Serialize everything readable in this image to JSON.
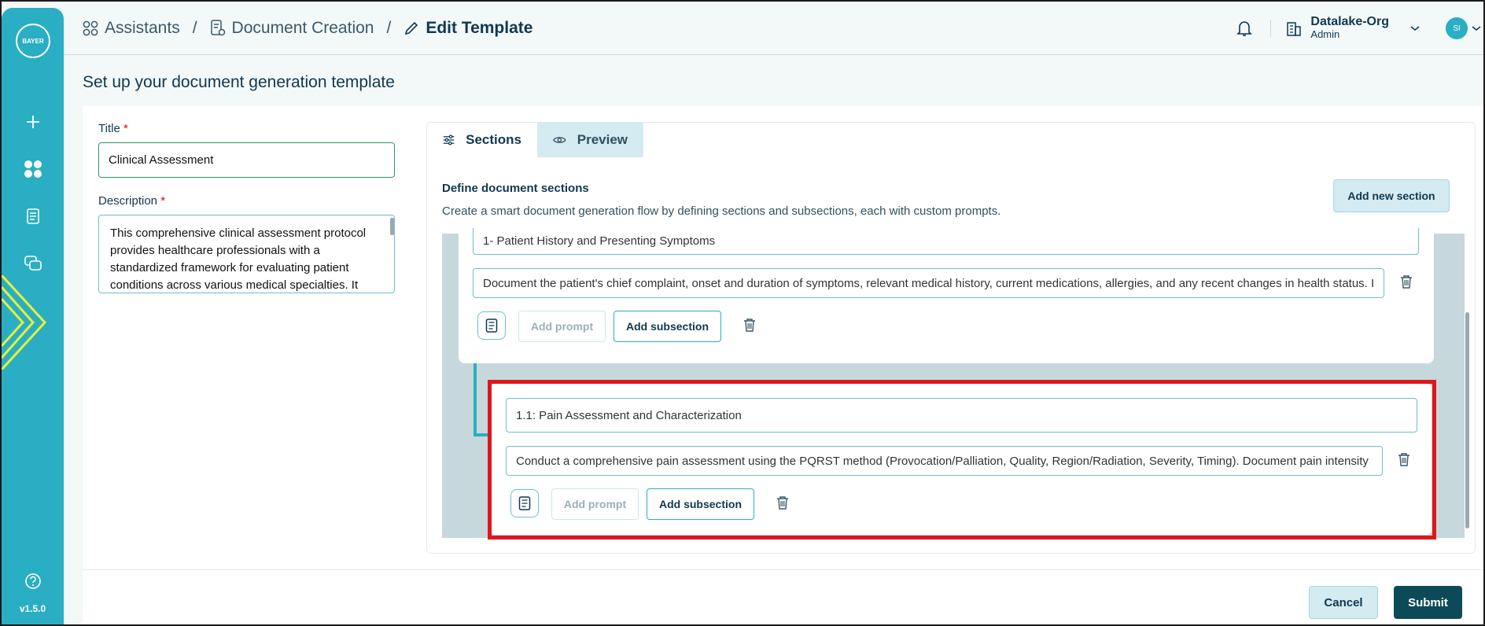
{
  "app": {
    "logo_text": "BAYER",
    "version": "v1.5.0",
    "accent": "#2aaec3",
    "dark": "#0d4a57"
  },
  "sidebar": {
    "items": [
      {
        "icon": "plus-icon"
      },
      {
        "icon": "apps-grid-icon"
      },
      {
        "icon": "document-icon"
      },
      {
        "icon": "chat-icon"
      },
      {
        "icon": "help-icon"
      }
    ]
  },
  "breadcrumb": {
    "items": [
      {
        "label": "Assistants",
        "icon": "apps-grid-icon"
      },
      {
        "label": "Document Creation",
        "icon": "document-gear-icon"
      },
      {
        "label": "Edit Template",
        "icon": "pencil-icon"
      }
    ]
  },
  "header": {
    "org_name": "Datalake-Org",
    "org_role": "Admin",
    "avatar_initials": "SI"
  },
  "page": {
    "title": "Set up your document generation template"
  },
  "form": {
    "title_label": "Title",
    "title_value": "Clinical Assessment",
    "description_label": "Description",
    "description_value": "This comprehensive clinical assessment protocol provides healthcare professionals with a standardized framework for evaluating patient conditions across various medical specialties. It",
    "required_mark": "*"
  },
  "tabs": [
    {
      "label": "Sections",
      "icon": "sliders-icon",
      "active": true
    },
    {
      "label": "Preview",
      "icon": "eye-icon",
      "active": false
    }
  ],
  "sections_panel": {
    "title": "Define document sections",
    "subtitle": "Create a smart document generation flow by defining sections and subsections, each with custom prompts.",
    "add_section_label": "Add new section",
    "sections": [
      {
        "title": "1- Patient History and Presenting Symptoms",
        "prompt": "Document the patient's chief complaint, onset and duration of symptoms, relevant medical history, current medications, allergies, and any recent changes in health status. I",
        "add_prompt_label": "Add prompt",
        "add_subsection_label": "Add subsection"
      },
      {
        "title": "1.1: Pain Assessment and Characterization",
        "prompt": "Conduct a comprehensive pain assessment using the PQRST method (Provocation/Palliation, Quality, Region/Radiation, Severity, Timing). Document pain intensity",
        "add_prompt_label": "Add prompt",
        "add_subsection_label": "Add subsection"
      }
    ]
  },
  "footer": {
    "cancel_label": "Cancel",
    "submit_label": "Submit"
  }
}
